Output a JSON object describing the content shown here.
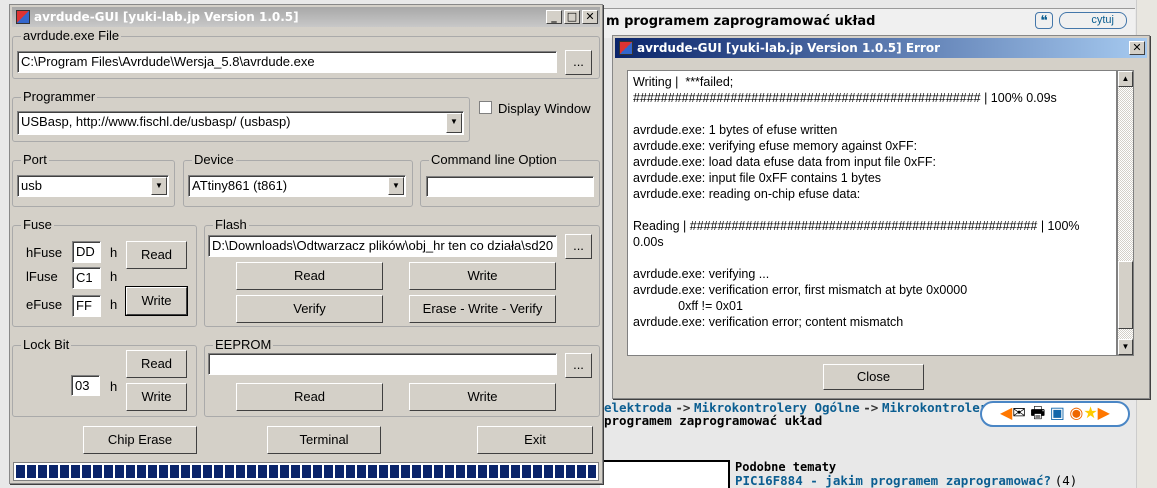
{
  "main": {
    "title": "avrdude-GUI [yuki-lab.jp Version 1.0.5]",
    "exe_group": "avrdude.exe File",
    "exe_path": "C:\\Program Files\\Avrdude\\Wersja_5.8\\avrdude.exe",
    "browse": "...",
    "programmer_group": "Programmer",
    "programmer": "USBasp, http://www.fischl.de/usbasp/ (usbasp)",
    "display_window": "Display Window",
    "port_group": "Port",
    "port": "usb",
    "device_group": "Device",
    "device": "ATtiny861 (t861)",
    "cmd_group": "Command line Option",
    "cmd": "",
    "fuse_group": "Fuse",
    "hfuse_label": "hFuse",
    "hfuse": "DD",
    "lfuse_label": "lFuse",
    "lfuse": "C1",
    "efuse_label": "eFuse",
    "efuse": "FF",
    "h": "h",
    "read": "Read",
    "write": "Write",
    "flash_group": "Flash",
    "flash_path": "D:\\Downloads\\Odtwarzacz plików\\obj_hr ten co działa\\sd20",
    "verify": "Verify",
    "erase_write_verify": "Erase - Write - Verify",
    "lock_group": "Lock Bit",
    "lock": "03",
    "eeprom_group": "EEPROM",
    "eeprom_path": "",
    "chip_erase": "Chip Erase",
    "terminal": "Terminal",
    "exit": "Exit",
    "progress": 100
  },
  "error": {
    "title": "avrdude-GUI [yuki-lab.jp Version 1.0.5] Error",
    "close": "Close",
    "log": [
      "Writing |  ***failed;",
      "################################################## | 100% 0.09s",
      "",
      "avrdude.exe: 1 bytes of efuse written",
      "avrdude.exe: verifying efuse memory against 0xFF:",
      "avrdude.exe: load data efuse data from input file 0xFF:",
      "avrdude.exe: input file 0xFF contains 1 bytes",
      "avrdude.exe: reading on-chip efuse data:",
      "",
      "Reading | ################################################## | 100%",
      "0.00s",
      "",
      "avrdude.exe: verifying ...",
      "avrdude.exe: verification error, first mismatch at byte 0x0000",
      "             0xff != 0x01",
      "avrdude.exe: verification error; content mismatch"
    ]
  },
  "forum": {
    "post_title": "m programem zaprogramować układ",
    "quote": "cytuj",
    "breadcrumb": [
      "elektroda",
      "Mikrokontrolery Ogólne",
      "Mikrokontrolery"
    ],
    "sep": "->",
    "topic": "programem zaprogramować układ",
    "similar": "Podobne tematy",
    "similar_link": "PIC16F884 - jakim programem zaprogramować?",
    "similar_count": "(4)"
  }
}
